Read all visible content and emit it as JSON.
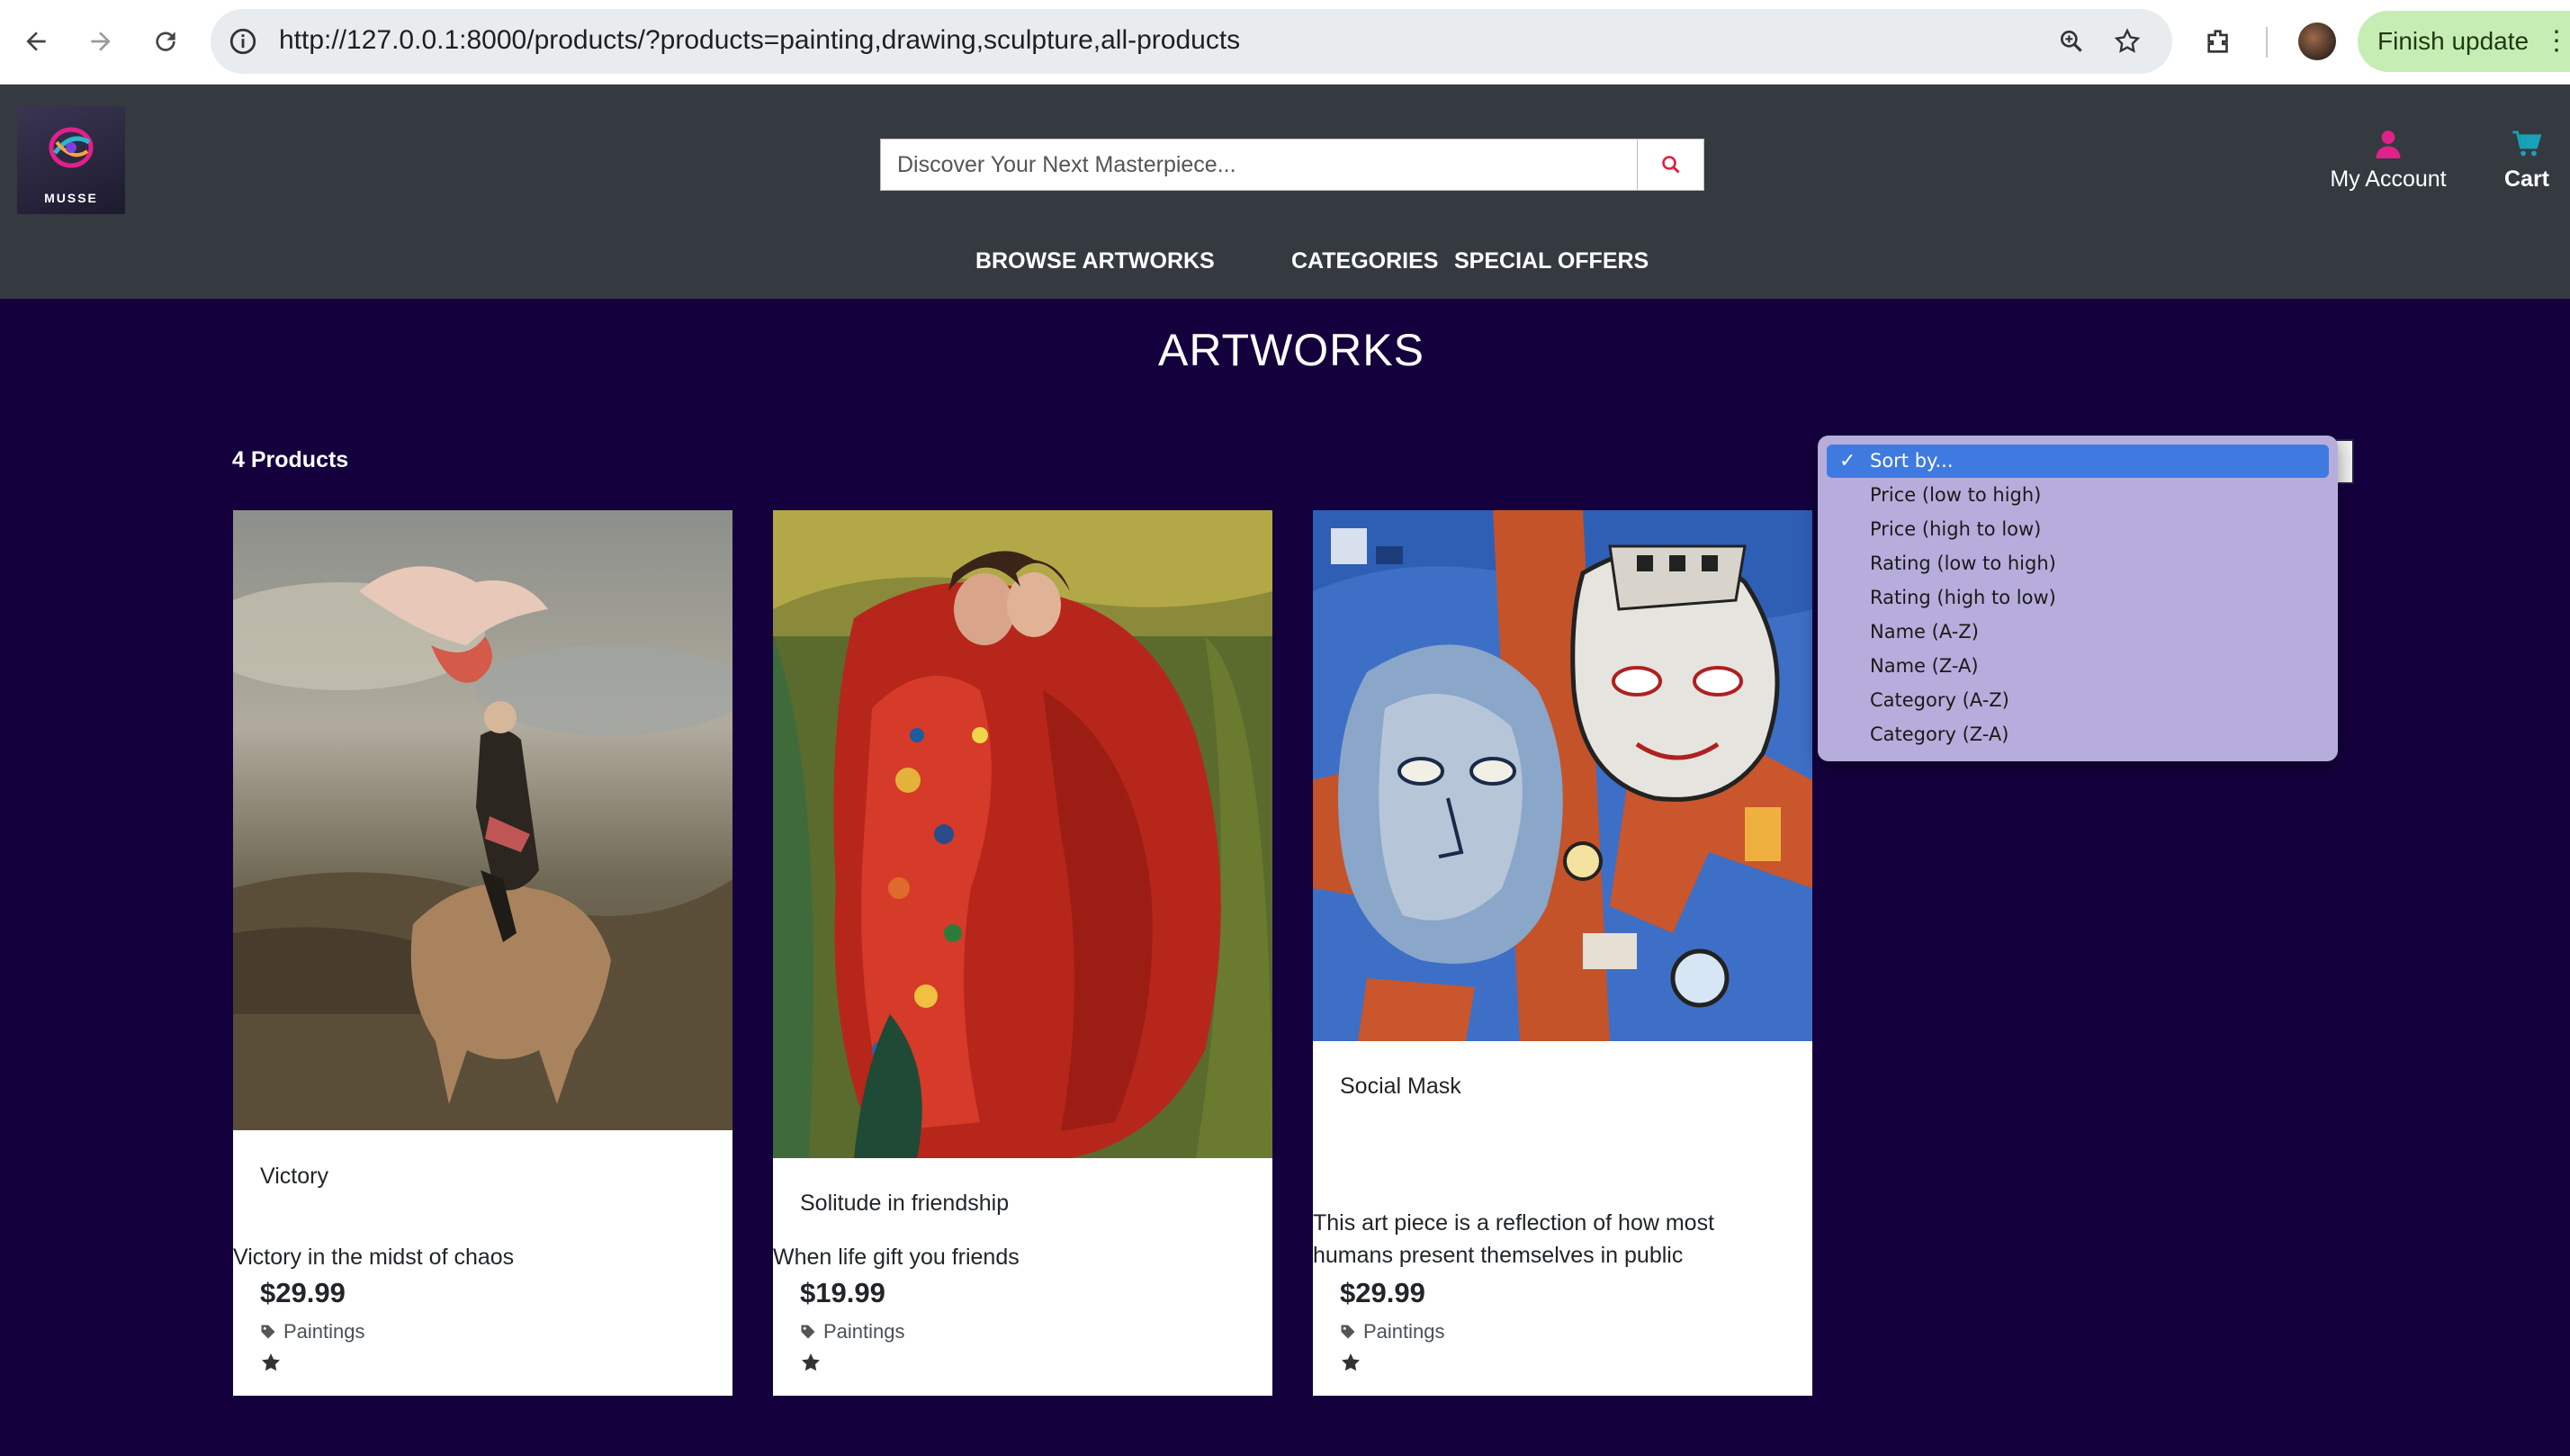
{
  "browser": {
    "url": "http://127.0.0.1:8000/products/?products=painting,drawing,sculpture,all-products",
    "update_label": "Finish update"
  },
  "header": {
    "logo_text": "MUSSE",
    "search_placeholder": "Discover Your Next Masterpiece...",
    "account_label": "My Account",
    "cart_label": "Cart",
    "nav": {
      "browse": "BROWSE ARTWORKS",
      "categories": "CATEGORIES",
      "offers": "SPECIAL OFFERS"
    },
    "accent_color": "#e0218a",
    "cart_color": "#17a2b8"
  },
  "main": {
    "title": "ARTWORKS",
    "count_label": "4 Products",
    "background": "#14003d"
  },
  "sort": {
    "options": [
      "Sort by...",
      "Price (low to high)",
      "Price (high to low)",
      "Rating (low to high)",
      "Rating (high to low)",
      "Name (A-Z)",
      "Name (Z-A)",
      "Category (A-Z)",
      "Category (Z-A)"
    ],
    "selected_index": 0
  },
  "products": [
    {
      "name": "Victory",
      "description": "Victory in the midst of chaos",
      "price": "$29.99",
      "category": "Paintings",
      "rating_stars": 1
    },
    {
      "name": "Solitude in friendship",
      "description": "When life gift you friends",
      "price": "$19.99",
      "category": "Paintings",
      "rating_stars": 1
    },
    {
      "name": "Social Mask",
      "description": "This art piece is a reflection of how most humans present themselves in public",
      "price": "$29.99",
      "category": "Paintings",
      "rating_stars": 1
    }
  ]
}
